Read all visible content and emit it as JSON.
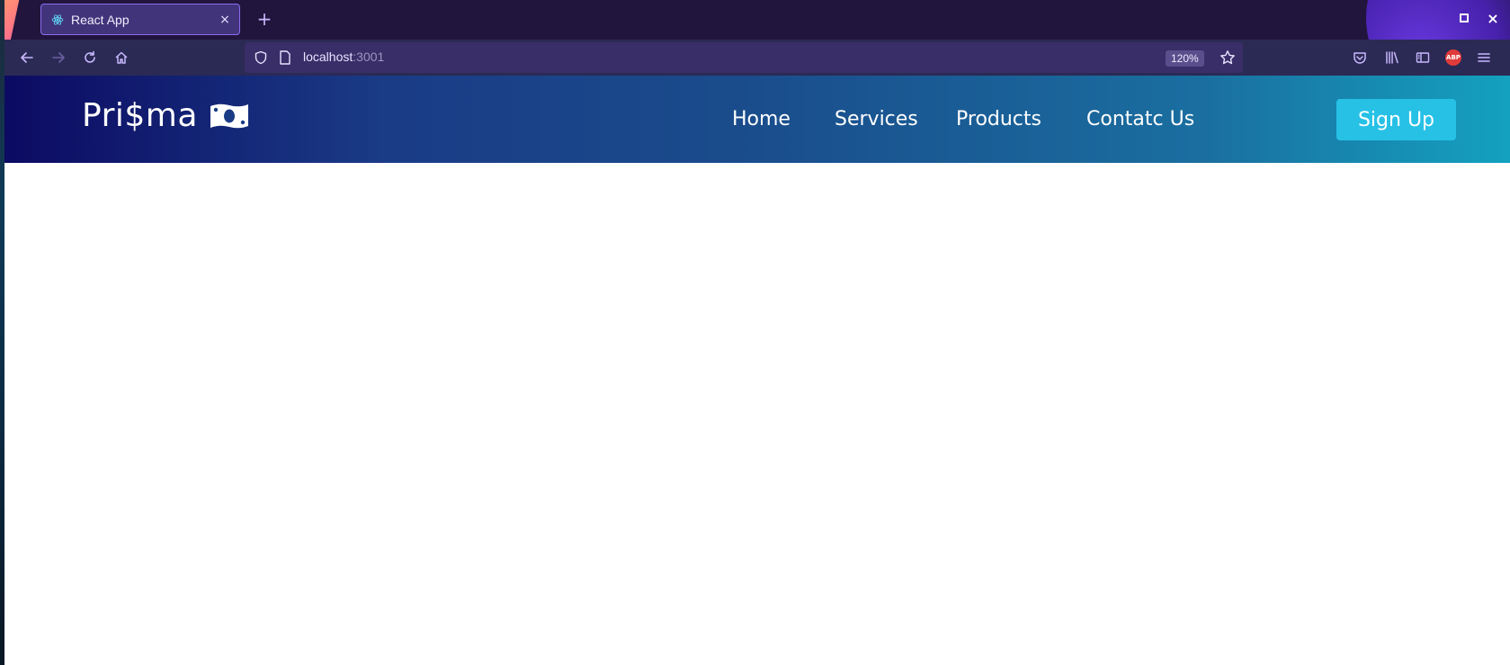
{
  "browser": {
    "tab": {
      "title": "React App",
      "close_glyph": "×",
      "icon": "react-atom-icon"
    },
    "new_tab_glyph": "+",
    "window_close_glyph": "×",
    "url": {
      "host": "localhost",
      "port": ":3001"
    },
    "zoom": "120%",
    "abp_label": "ABP",
    "colors": {
      "tabbar": "#22153d",
      "navbar": "#2b2a54",
      "urlbar": "#392e68",
      "accent": "#8a6cf0"
    }
  },
  "site": {
    "logo_text": "Pri$ma",
    "logo_icon": "money-bill-icon",
    "menu": [
      {
        "label": "Home"
      },
      {
        "label": "Services"
      },
      {
        "label": "Products"
      },
      {
        "label": "Contatc Us"
      }
    ],
    "signup_label": "Sign Up",
    "colors": {
      "header_start": "#0c0a62",
      "header_end": "#14a1bf",
      "signup_bg": "#27c1e6"
    }
  }
}
